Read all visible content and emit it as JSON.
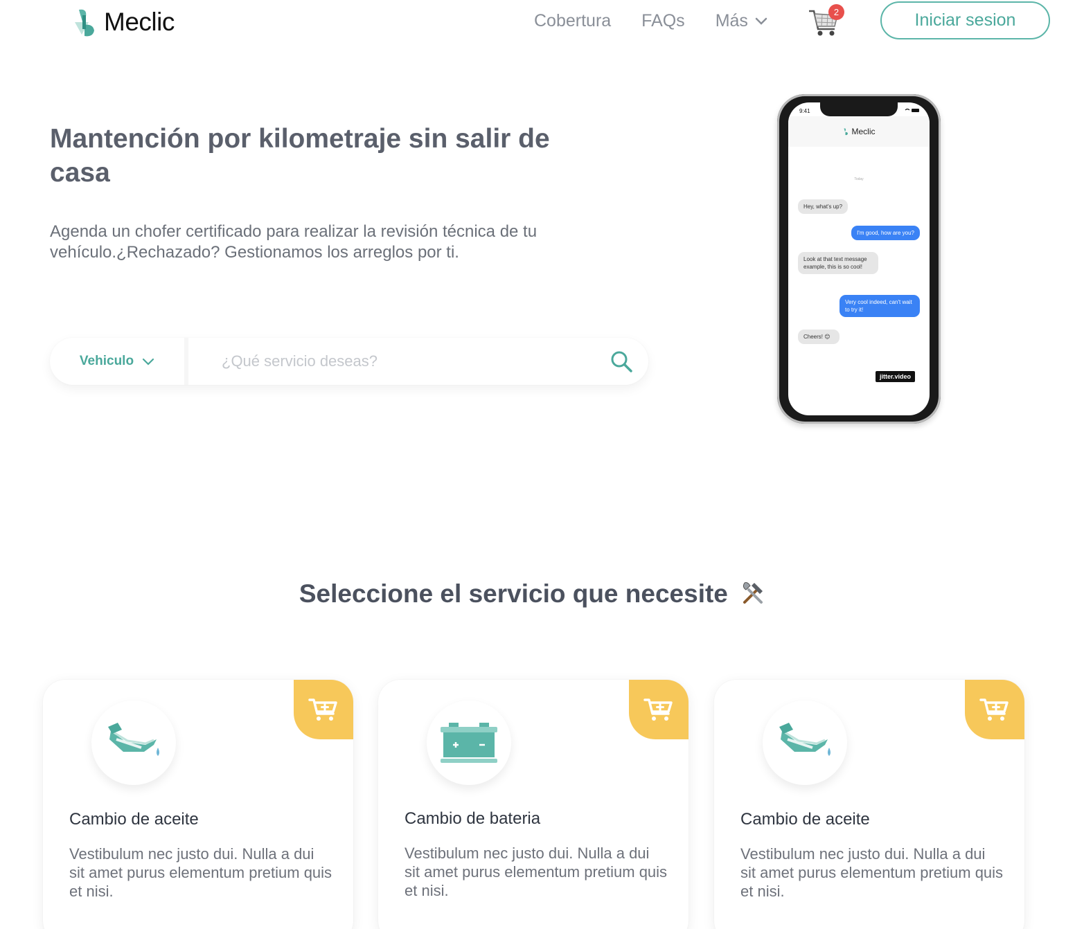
{
  "brand": {
    "name": "Meclic",
    "color": "#4aa89b"
  },
  "nav": {
    "links": [
      "Cobertura",
      "FAQs",
      "Más"
    ],
    "cart_count": "2",
    "login_label": "Iniciar sesion"
  },
  "hero": {
    "title": "Mantención por kilometraje sin salir de casa",
    "subtitle": "Agenda un chofer certificado para realizar la revisión técnica de tu vehículo.¿Rechazado? Gestionamos los arreglos por ti.",
    "vehicle_select": "Vehiculo",
    "search_placeholder": "¿Qué servicio deseas?"
  },
  "phone": {
    "time": "9:41",
    "app_name": "Meclic",
    "day_label": "Today",
    "messages": [
      {
        "from": "in",
        "text": "Hey, what's up?"
      },
      {
        "from": "out",
        "text": "I'm good, how are you?"
      },
      {
        "from": "in",
        "text": "Look at that text message example, this is so cool!"
      },
      {
        "from": "out",
        "text": "Very cool indeed, can't wait to try it!"
      },
      {
        "from": "in",
        "text": "Cheers! 😊"
      }
    ],
    "watermark": "jitter.video"
  },
  "services": {
    "title": "Seleccione el servicio que necesite",
    "title_icon": "hammer-wrench-icon",
    "accent_color": "#f7c85a",
    "cards": [
      {
        "icon": "oil-can-icon",
        "title": "Cambio de aceite",
        "description": "Vestibulum nec justo dui. Nulla a dui sit amet purus elementum pretium quis et nisi."
      },
      {
        "icon": "battery-icon",
        "title": "Cambio de bateria",
        "description": "Vestibulum nec justo dui. Nulla a dui sit amet purus elementum pretium quis et nisi."
      },
      {
        "icon": "oil-can-icon",
        "title": "Cambio de aceite",
        "description": "Vestibulum nec justo dui. Nulla a dui sit amet purus elementum pretium quis et nisi."
      }
    ]
  }
}
